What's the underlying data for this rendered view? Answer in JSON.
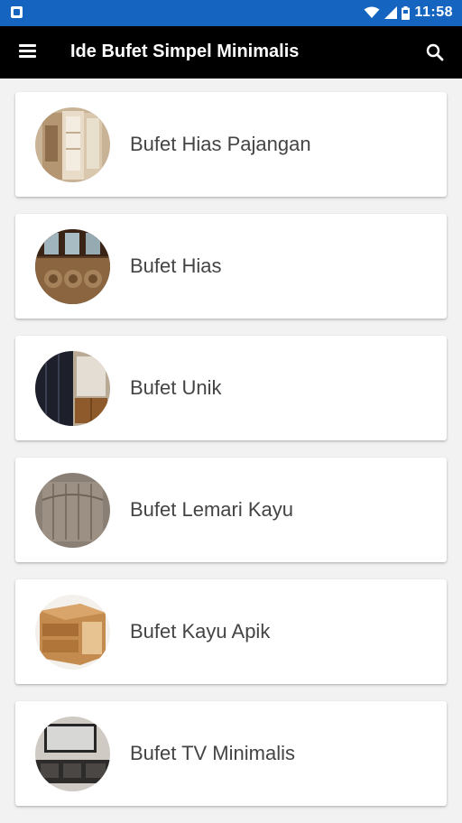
{
  "status_bar": {
    "time": "11:58",
    "icons": [
      "app-notification-icon",
      "wifi-icon",
      "signal-icon",
      "battery-icon"
    ]
  },
  "app_bar": {
    "title": "Ide Bufet Simpel Minimalis",
    "menu_icon": "hamburger-menu-icon",
    "search_icon": "search-icon"
  },
  "items": [
    {
      "label": "Bufet Hias Pajangan"
    },
    {
      "label": "Bufet Hias"
    },
    {
      "label": "Bufet Unik"
    },
    {
      "label": "Bufet Lemari Kayu"
    },
    {
      "label": "Bufet Kayu Apik"
    },
    {
      "label": "Bufet TV Minimalis"
    }
  ],
  "colors": {
    "status_bar": "#1565c0",
    "app_bar": "#000000",
    "background": "#f2f2f2",
    "card": "#ffffff",
    "text": "#444444"
  }
}
